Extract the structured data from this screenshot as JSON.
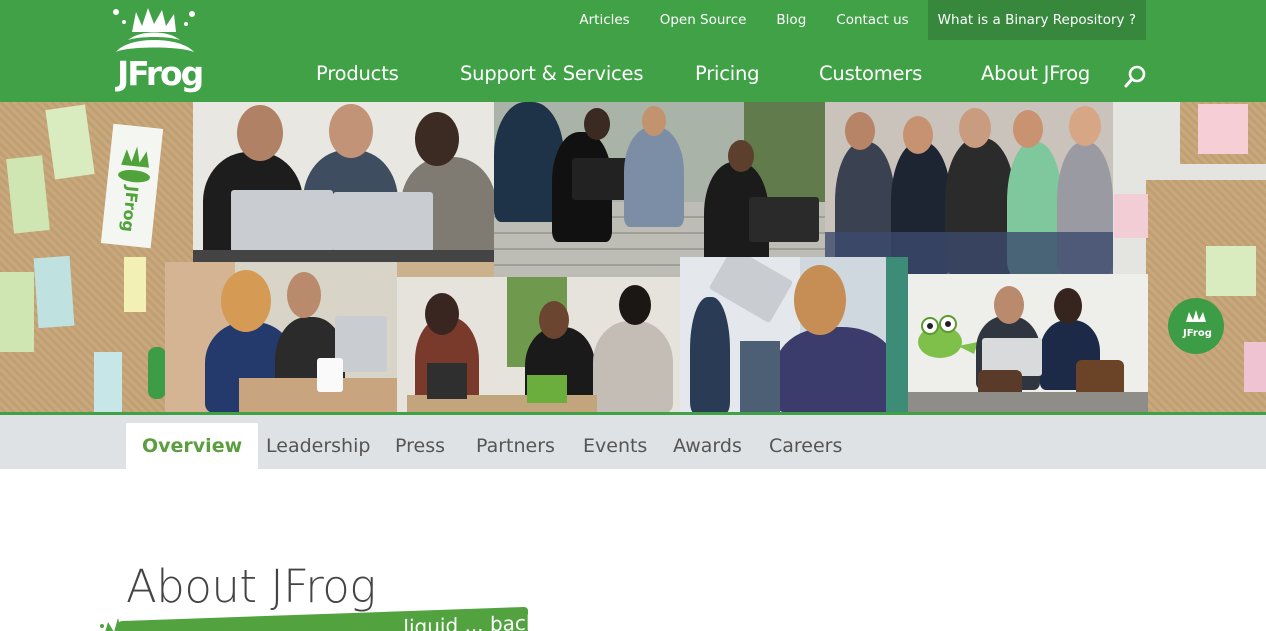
{
  "brand": {
    "logo_text": "JFrog",
    "color": "#40a147",
    "dark_color": "#37873d",
    "subnav_active_color": "#5a9e3d"
  },
  "top_nav": {
    "items": [
      {
        "label": "Articles"
      },
      {
        "label": "Open Source"
      },
      {
        "label": "Blog"
      },
      {
        "label": "Contact us"
      },
      {
        "label": "What is a Binary Repository ?"
      }
    ]
  },
  "main_nav": {
    "items": [
      {
        "label": "Products"
      },
      {
        "label": "Support & Services"
      },
      {
        "label": "Pricing"
      },
      {
        "label": "Customers"
      },
      {
        "label": "About JFrog"
      }
    ],
    "search_icon": "search-icon"
  },
  "hero": {
    "description_icon": "team-photo-collage"
  },
  "sub_nav": {
    "tabs": [
      {
        "label": "Overview",
        "active": true
      },
      {
        "label": "Leadership",
        "active": false
      },
      {
        "label": "Press",
        "active": false
      },
      {
        "label": "Partners",
        "active": false
      },
      {
        "label": "Events",
        "active": false
      },
      {
        "label": "Awards",
        "active": false
      },
      {
        "label": "Careers",
        "active": false
      }
    ]
  },
  "content": {
    "title": "About JFrog",
    "banner_text": "... liquid ... back"
  }
}
